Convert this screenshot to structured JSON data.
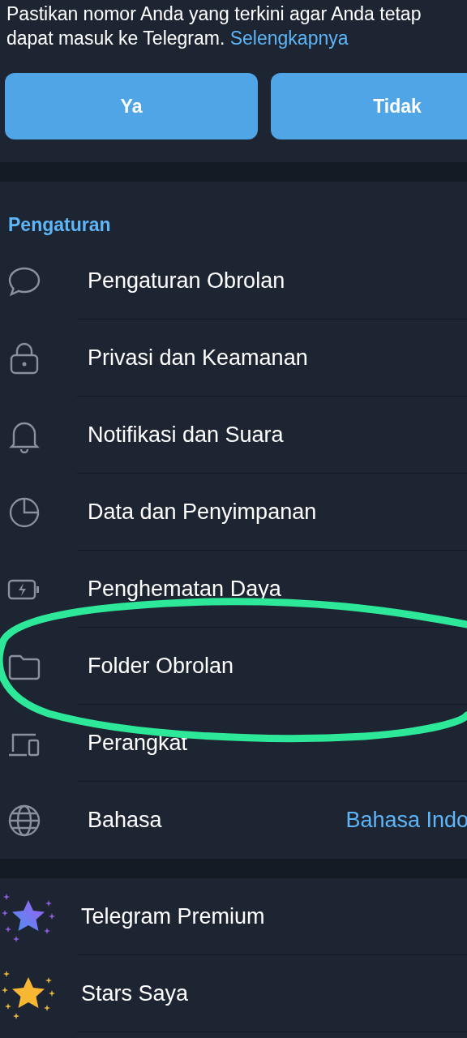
{
  "notice": {
    "text": "Pastikan nomor Anda yang terkini agar Anda tetap dapat masuk ke Telegram.",
    "link": "Selengkapnya"
  },
  "buttons": [
    "Ya",
    "Tidak"
  ],
  "section": {
    "title": "Pengaturan"
  },
  "settings": [
    {
      "label": "Pengaturan Obrolan"
    },
    {
      "label": "Privasi dan Keamanan"
    },
    {
      "label": "Notifikasi dan Suara"
    },
    {
      "label": "Data dan Penyimpanan"
    },
    {
      "label": "Penghematan Daya"
    },
    {
      "label": "Folder Obrolan"
    },
    {
      "label": "Perangkat"
    },
    {
      "label": "Bahasa",
      "value": "Bahasa Indo"
    }
  ],
  "extras": [
    {
      "label": "Telegram Premium"
    },
    {
      "label": "Stars Saya"
    }
  ],
  "annotation": {
    "kind": "ellipse"
  }
}
